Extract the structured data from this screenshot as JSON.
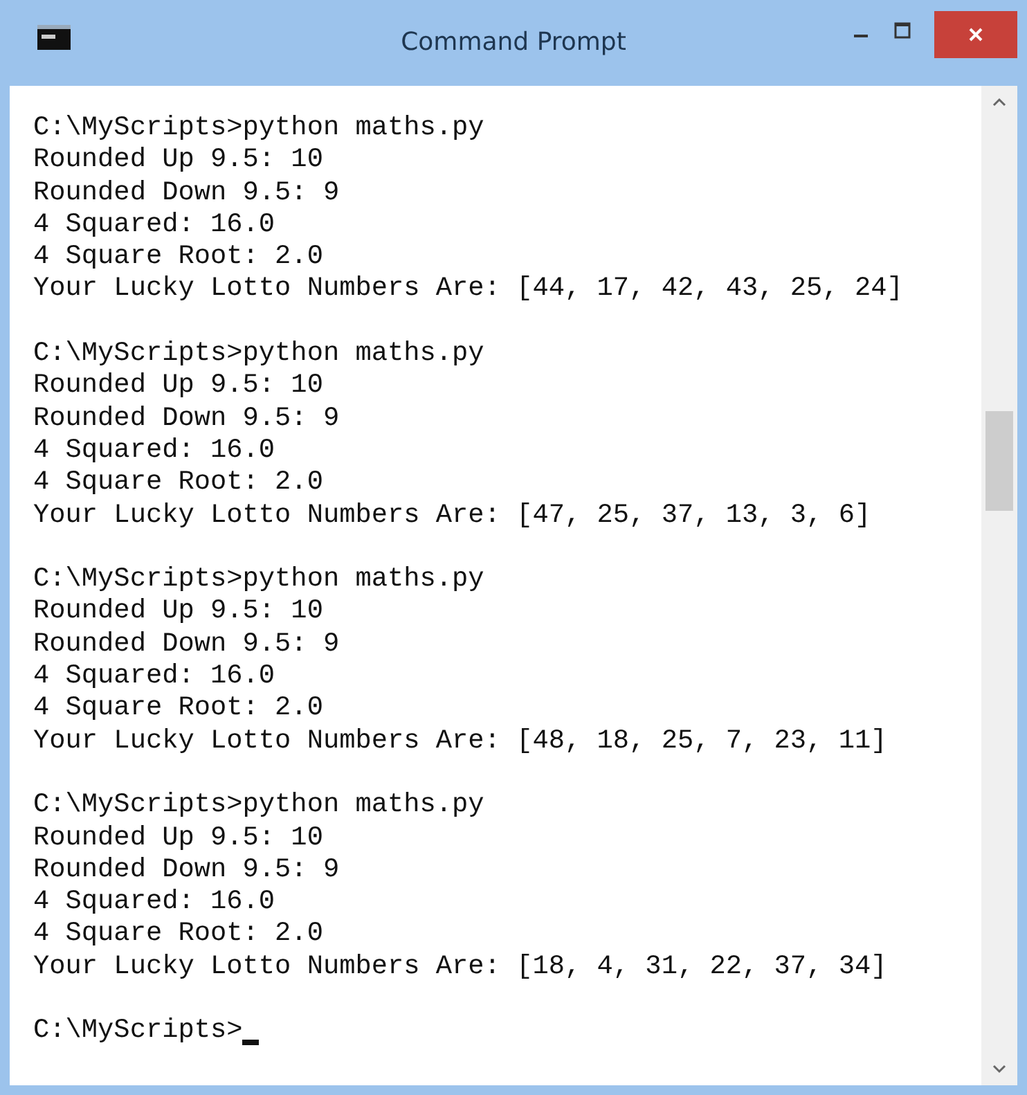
{
  "window": {
    "title": "Command Prompt"
  },
  "console": {
    "blocks": [
      [
        "C:\\MyScripts>python maths.py",
        "Rounded Up 9.5: 10",
        "Rounded Down 9.5: 9",
        "4 Squared: 16.0",
        "4 Square Root: 2.0",
        "Your Lucky Lotto Numbers Are: [44, 17, 42, 43, 25, 24]"
      ],
      [
        "C:\\MyScripts>python maths.py",
        "Rounded Up 9.5: 10",
        "Rounded Down 9.5: 9",
        "4 Squared: 16.0",
        "4 Square Root: 2.0",
        "Your Lucky Lotto Numbers Are: [47, 25, 37, 13, 3, 6]"
      ],
      [
        "C:\\MyScripts>python maths.py",
        "Rounded Up 9.5: 10",
        "Rounded Down 9.5: 9",
        "4 Squared: 16.0",
        "4 Square Root: 2.0",
        "Your Lucky Lotto Numbers Are: [48, 18, 25, 7, 23, 11]"
      ],
      [
        "C:\\MyScripts>python maths.py",
        "Rounded Up 9.5: 10",
        "Rounded Down 9.5: 9",
        "4 Squared: 16.0",
        "4 Square Root: 2.0",
        "Your Lucky Lotto Numbers Are: [18, 4, 31, 22, 37, 34]"
      ],
      [
        "C:\\MyScripts>"
      ]
    ],
    "cursor_visible": true
  }
}
